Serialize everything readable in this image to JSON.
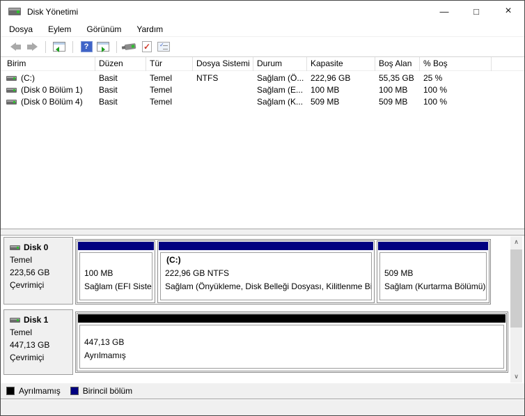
{
  "window": {
    "title": "Disk Yönetimi",
    "minimize_glyph": "—",
    "maximize_glyph": "□",
    "close_glyph": "×"
  },
  "menu": {
    "items": [
      "Dosya",
      "Eylem",
      "Görünüm",
      "Yardım"
    ]
  },
  "toolbar": {
    "help_glyph": "?",
    "tasklist_glyph": "✓",
    "checkdoc_glyph": "✓",
    "icons": [
      "back",
      "forward",
      "show-console-tree",
      "help",
      "show-action-pane",
      "connect-device",
      "validate-document",
      "properties-list"
    ]
  },
  "volume_list": {
    "columns": [
      "Birim",
      "Düzen",
      "Tür",
      "Dosya Sistemi",
      "Durum",
      "Kapasite",
      "Boş Alan",
      "% Boş"
    ],
    "rows": [
      {
        "birim": "(C:)",
        "duzen": "Basit",
        "tur": "Temel",
        "dosya_sistemi": "NTFS",
        "durum": "Sağlam (Ö...",
        "kapasite": "222,96 GB",
        "bos_alan": "55,35 GB",
        "pct_bos": "25 %"
      },
      {
        "birim": "(Disk 0 Bölüm 1)",
        "duzen": "Basit",
        "tur": "Temel",
        "dosya_sistemi": "",
        "durum": "Sağlam (E...",
        "kapasite": "100 MB",
        "bos_alan": "100 MB",
        "pct_bos": "100 %"
      },
      {
        "birim": "(Disk 0 Bölüm 4)",
        "duzen": "Basit",
        "tur": "Temel",
        "dosya_sistemi": "",
        "durum": "Sağlam (K...",
        "kapasite": "509 MB",
        "bos_alan": "509 MB",
        "pct_bos": "100 %"
      }
    ]
  },
  "disks": [
    {
      "name": "Disk 0",
      "type": "Temel",
      "size": "223,56 GB",
      "status": "Çevrimiçi",
      "partitions": [
        {
          "title": "",
          "size_line": "100 MB",
          "status_line": "Sağlam (EFI Sistem",
          "color": "#000080"
        },
        {
          "title": "(C:)",
          "size_line": "222,96 GB NTFS",
          "status_line": "Sağlam (Önyükleme, Disk Belleği Dosyası, Kilitlenme Bilg",
          "color": "#000080"
        },
        {
          "title": "",
          "size_line": "509 MB",
          "status_line": "Sağlam (Kurtarma Bölümü)",
          "color": "#000080"
        }
      ]
    },
    {
      "name": "Disk 1",
      "type": "Temel",
      "size": "447,13 GB",
      "status": "Çevrimiçi",
      "partitions": [
        {
          "title": "",
          "size_line": "447,13 GB",
          "status_line": "Ayrılmamış",
          "color": "#000000"
        }
      ]
    }
  ],
  "scrollbar": {
    "up_glyph": "∧",
    "down_glyph": "∨"
  },
  "legend": [
    {
      "label": "Ayrılmamış",
      "color": "#000000"
    },
    {
      "label": "Birincil bölüm",
      "color": "#000080"
    }
  ],
  "colors": {
    "primary_partition": "#000080",
    "unallocated": "#000000",
    "panel_gray": "#f0f0f0",
    "selection_navy": "#000080"
  }
}
